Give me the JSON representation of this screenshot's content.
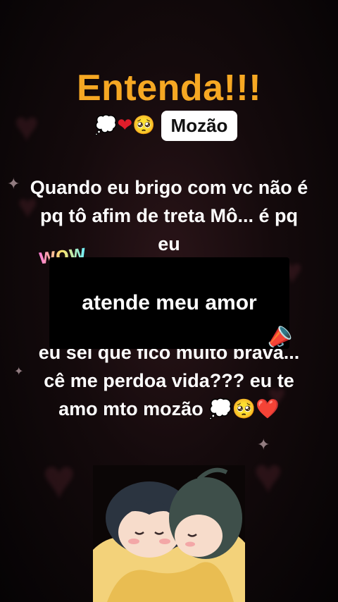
{
  "title": "Entenda!!!",
  "subtitle": {
    "emojis": "💭❤️🥺",
    "name": "Mozão"
  },
  "message_top": "Quando eu brigo com vc não é  pq tô afim de treta Mô... é  pq eu",
  "overlay_text": "atende meu amor",
  "sticker_text": "WOW",
  "message_bottom": "eu sei que fico muito brava... cê  me perdoa vida??? eu te amo mto mozão 💭🥺❤️",
  "icons": {
    "thought": "thought-bubble-icon",
    "heart": "red-heart-icon",
    "pleading": "pleading-face-icon",
    "horn": "party-horn-icon"
  },
  "colors": {
    "title": "#f6a823",
    "heart": "#e11d2a",
    "background": "#140a0c"
  }
}
